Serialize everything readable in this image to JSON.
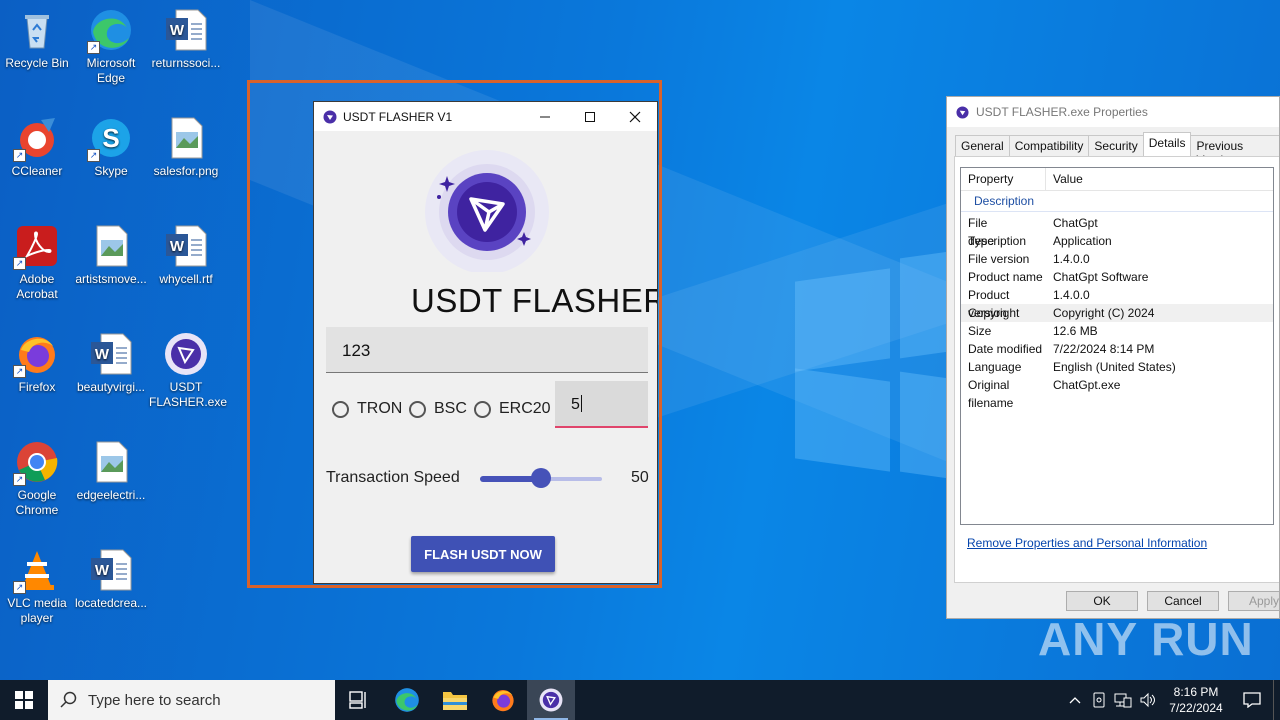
{
  "desktop": {
    "icons": [
      {
        "label": "Recycle Bin",
        "icon": "recycle-bin-icon"
      },
      {
        "label": "Microsoft Edge",
        "icon": "edge-icon"
      },
      {
        "label": "returnssoci...",
        "icon": "word-doc-icon"
      },
      {
        "label": "CCleaner",
        "icon": "ccleaner-icon"
      },
      {
        "label": "Skype",
        "icon": "skype-icon"
      },
      {
        "label": "salesfor.png",
        "icon": "image-file-icon"
      },
      {
        "label": "Adobe Acrobat",
        "icon": "acrobat-icon"
      },
      {
        "label": "artistsmove...",
        "icon": "image-file-icon"
      },
      {
        "label": "whycell.rtf",
        "icon": "word-doc-icon"
      },
      {
        "label": "Firefox",
        "icon": "firefox-icon"
      },
      {
        "label": "beautyvirgi...",
        "icon": "word-doc-icon"
      },
      {
        "label": "USDT FLASHER.exe",
        "icon": "usdt-flasher-icon"
      },
      {
        "label": "Google Chrome",
        "icon": "chrome-icon"
      },
      {
        "label": "edgeelectri...",
        "icon": "image-file-icon"
      },
      {
        "label": "VLC media player",
        "icon": "vlc-icon"
      },
      {
        "label": "locatedcrea...",
        "icon": "word-doc-icon"
      }
    ]
  },
  "app": {
    "title": "USDT FLASHER V1",
    "heading": "USDT FLASHER",
    "amount_value": "123",
    "networks": [
      {
        "label": "TRON",
        "selected": false
      },
      {
        "label": "BSC",
        "selected": false
      },
      {
        "label": "ERC20",
        "selected": false
      }
    ],
    "count_value": "5",
    "speed_label": "Transaction Speed",
    "speed_value": "50",
    "speed_fraction": 0.5,
    "button_label": "FLASH USDT NOW",
    "accent_color": "#3f51b5"
  },
  "properties": {
    "title": "USDT FLASHER.exe Properties",
    "tabs": [
      "General",
      "Compatibility",
      "Security",
      "Details",
      "Previous Versions"
    ],
    "active_tab": "Details",
    "columns": [
      "Property",
      "Value"
    ],
    "section": "Description",
    "rows": [
      {
        "property": "File description",
        "value": "ChatGpt"
      },
      {
        "property": "Type",
        "value": "Application"
      },
      {
        "property": "File version",
        "value": "1.4.0.0"
      },
      {
        "property": "Product name",
        "value": "ChatGpt Software"
      },
      {
        "property": "Product version",
        "value": "1.4.0.0"
      },
      {
        "property": "Copyright",
        "value": "Copyright (C) 2024"
      },
      {
        "property": "Size",
        "value": "12.6 MB"
      },
      {
        "property": "Date modified",
        "value": "7/22/2024 8:14 PM"
      },
      {
        "property": "Language",
        "value": "English (United States)"
      },
      {
        "property": "Original filename",
        "value": "ChatGpt.exe"
      }
    ],
    "remove_link": "Remove Properties and Personal Information",
    "ok_label": "OK",
    "cancel_label": "Cancel",
    "apply_label": "Apply"
  },
  "watermark": "ANY RUN",
  "taskbar": {
    "search_placeholder": "Type here to search",
    "time": "8:16 PM",
    "date": "7/22/2024"
  }
}
